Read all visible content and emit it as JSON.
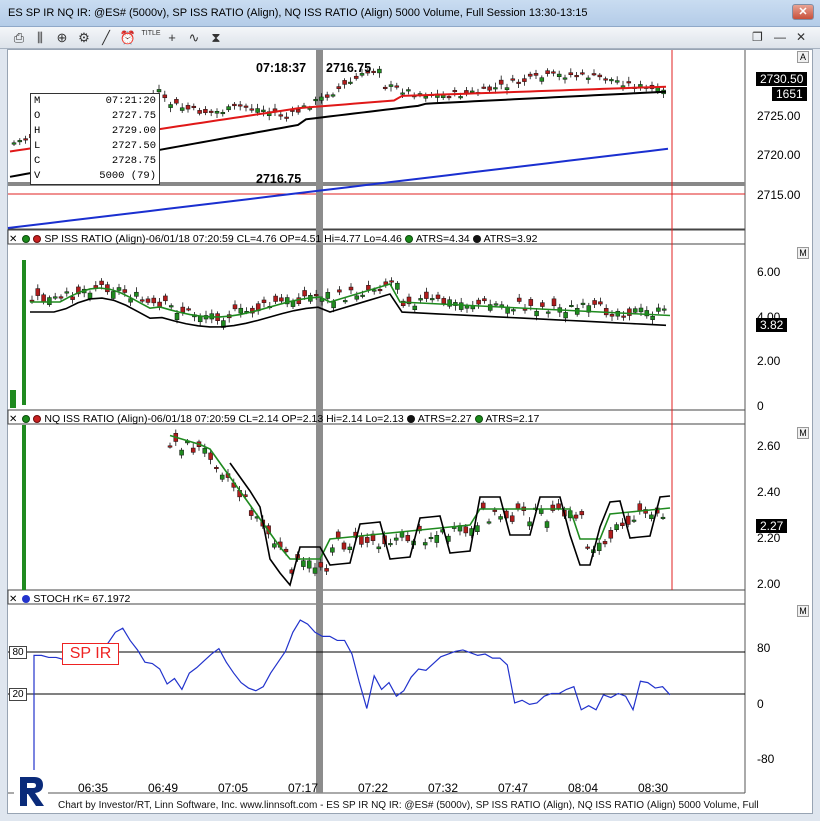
{
  "window": {
    "title": "ES SP IR NQ IR: @ES# (5000v), SP ISS RATIO (Align), NQ ISS RATIO (Align) 5000 Volume, Full Session 13:30-13:15"
  },
  "ohlc": {
    "rows": [
      {
        "k": "M",
        "v": "07:21:20"
      },
      {
        "k": "O",
        "v": "2727.75"
      },
      {
        "k": "H",
        "v": "2729.00"
      },
      {
        "k": "L",
        "v": "2727.50"
      },
      {
        "k": "C",
        "v": "2728.75"
      },
      {
        "k": "V",
        "v": "5000 (79)"
      }
    ]
  },
  "annotations": {
    "time": "07:18:37",
    "price_top": "2716.75",
    "price_bottom": "2716.75"
  },
  "price_panel": {
    "last_price": "2730.50",
    "volume_tag": "1651",
    "y_labels": [
      "2725.00",
      "2720.00",
      "2715.00"
    ],
    "marker": "A"
  },
  "sp_panel": {
    "header": "SP ISS RATIO (Align)-06/01/18 07:20:59 CL=4.76 OP=4.51 Hi=4.77 Lo=4.46",
    "atrs1": "ATRS=4.34",
    "atrs2": "ATRS=3.92",
    "last": "3.82",
    "y_labels": [
      "6.00",
      "4.00",
      "2.00",
      "0"
    ],
    "marker": "M"
  },
  "nq_panel": {
    "header": "NQ ISS RATIO (Align)-06/01/18 07:20:59 CL=2.14 OP=2.13 Hi=2.14 Lo=2.13",
    "atrs1": "ATRS=2.27",
    "atrs2": "ATRS=2.17",
    "last": "2.27",
    "y_labels": [
      "2.60",
      "2.40",
      "2.20",
      "2.00"
    ],
    "marker": "M"
  },
  "stoch_panel": {
    "header": "STOCH rK= 67.1972",
    "y_labels": [
      "80",
      "0",
      "-80"
    ],
    "levels": [
      "80",
      "20"
    ],
    "label_box": "SP IR",
    "marker": "M",
    "series": [
      70,
      70,
      67,
      67,
      64,
      66,
      60,
      62,
      68,
      80,
      88,
      104,
      110,
      92,
      78,
      60,
      58,
      50,
      28,
      36,
      20,
      44,
      52,
      62,
      72,
      80,
      60,
      44,
      30,
      22,
      18,
      24,
      44,
      60,
      76,
      104,
      122,
      116,
      104,
      98,
      98,
      92,
      92,
      72,
      30,
      -8,
      40,
      20,
      30,
      10,
      18,
      38,
      50,
      48,
      58,
      68,
      72,
      76,
      78,
      74,
      70,
      72,
      66,
      66,
      56,
      0,
      4,
      -2,
      0,
      10,
      14,
      14,
      20,
      24,
      -10,
      -4,
      -10,
      12,
      8,
      14,
      10,
      -10,
      32,
      30,
      22,
      24,
      12
    ]
  },
  "x_labels": [
    "06:35",
    "06:49",
    "07:05",
    "07:17",
    "07:22",
    "07:32",
    "07:47",
    "08:04",
    "08:30"
  ],
  "footer": "Chart by Investor/RT, Linn Software, Inc. www.linnsoft.com - ES SP IR NQ IR: @ES# (5000v), SP ISS RATIO (Align), NQ ISS RATIO (Align) 5000 Volume, Full",
  "colors": {
    "up": "#1f8a1f",
    "down": "#b01c1c",
    "ma_red": "#e01818",
    "ma_black": "#000000",
    "ma_blue": "#1a2fd0",
    "stoch": "#2233cc"
  },
  "toolbar": {
    "icons": [
      "print-icon",
      "bars-icon",
      "zoom-icon",
      "gear-icon",
      "draw-line-icon",
      "clock-icon",
      "title-icon",
      "chart-small-icon",
      "crosshair-icon",
      "sine-icon",
      "hourglass-icon"
    ],
    "title_label": "TITLE"
  }
}
